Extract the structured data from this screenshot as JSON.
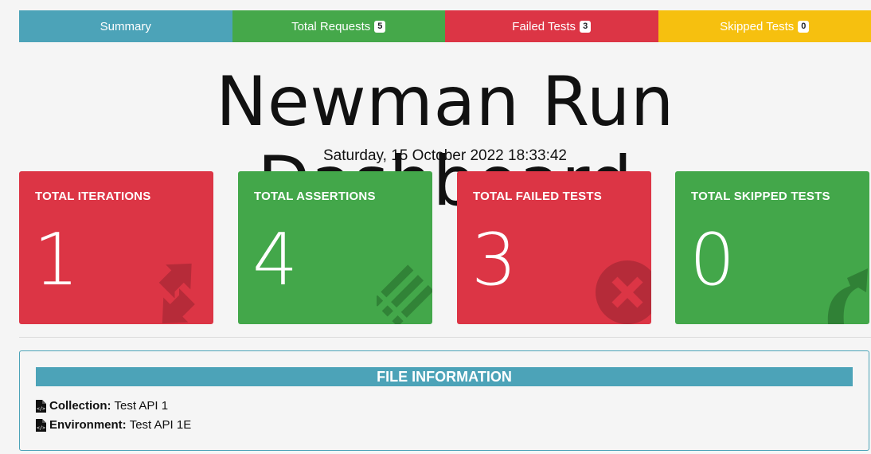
{
  "tabs": [
    {
      "label": "Summary",
      "badge": ""
    },
    {
      "label": "Total Requests",
      "badge": "5"
    },
    {
      "label": "Failed Tests",
      "badge": "3"
    },
    {
      "label": "Skipped Tests",
      "badge": "0"
    }
  ],
  "title": "Newman Run Dashboard",
  "run_date": "Saturday, 15 October 2022 18:33:42",
  "cards": [
    {
      "label": "TOTAL ITERATIONS",
      "value": "1",
      "icon": "refresh-icon",
      "color": "#dc3545"
    },
    {
      "label": "TOTAL ASSERTIONS",
      "value": "4",
      "icon": "list-icon",
      "color": "#43a74a"
    },
    {
      "label": "TOTAL FAILED TESTS",
      "value": "3",
      "icon": "times-circle-icon",
      "color": "#dc3545"
    },
    {
      "label": "TOTAL SKIPPED TESTS",
      "value": "0",
      "icon": "share-arrow-icon",
      "color": "#43a74a"
    }
  ],
  "file_info": {
    "header": "FILE INFORMATION",
    "collection_label": "Collection:",
    "collection_value": "Test API 1",
    "environment_label": "Environment:",
    "environment_value": "Test API 1E"
  },
  "colors": {
    "info": "#4ca3b8",
    "success": "#45a84a",
    "danger": "#dc3545",
    "warning": "#f6c00f"
  }
}
